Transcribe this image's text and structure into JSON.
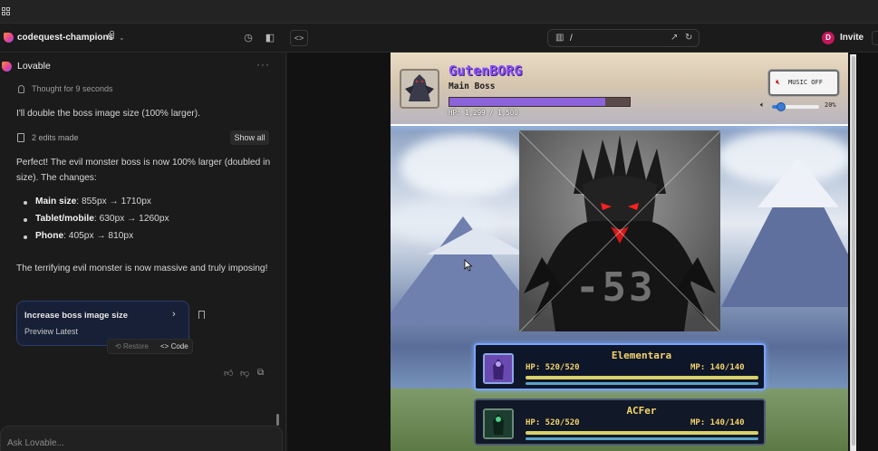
{
  "app": {
    "project_name": "codequest-champions",
    "invite_label": "Invite",
    "avatar_initial": "D",
    "url_path": "/"
  },
  "chat": {
    "title": "Lovable",
    "thought": "Thought for 9 seconds",
    "intro": "I'll double the boss image size (100% larger).",
    "edits": "2 edits made",
    "show_all": "Show all",
    "summary": "Perfect! The evil monster boss is now 100% larger (doubled in size). The changes:",
    "changes": [
      {
        "label": "Main size",
        "value": ": 855px → 1710px"
      },
      {
        "label": "Tablet/mobile",
        "value": ": 630px → 1260px"
      },
      {
        "label": "Phone",
        "value": ": 405px → 810px"
      }
    ],
    "closing": "The terrifying evil monster is now massive and truly imposing!",
    "version_card": {
      "title": "Increase boss image size",
      "subtitle": "Preview Latest"
    },
    "restore_label": "Restore",
    "code_label": "Code",
    "input_placeholder": "Ask Lovable..."
  },
  "game": {
    "boss": {
      "name": "GutenBORG",
      "role": "Main Boss",
      "hp_text": "HP: 1,299 / 1,500",
      "hp_current": 1299,
      "hp_max": 1500
    },
    "music_button": "MUSIC OFF",
    "volume_pct": "20%",
    "volume_value": 0.2,
    "damage_text": "-53",
    "heroes": [
      {
        "name": "Elementara",
        "hp": "HP: 520/520",
        "mp": "MP: 140/140"
      },
      {
        "name": "ACFer",
        "hp": "HP: 520/520",
        "mp": "MP: 140/140"
      }
    ]
  },
  "colors": {
    "boss_name": "#8a4fff",
    "hero_text": "#f2d36b",
    "hp_fill": "#8c63d9",
    "accent_blue": "#3a7bd5"
  }
}
